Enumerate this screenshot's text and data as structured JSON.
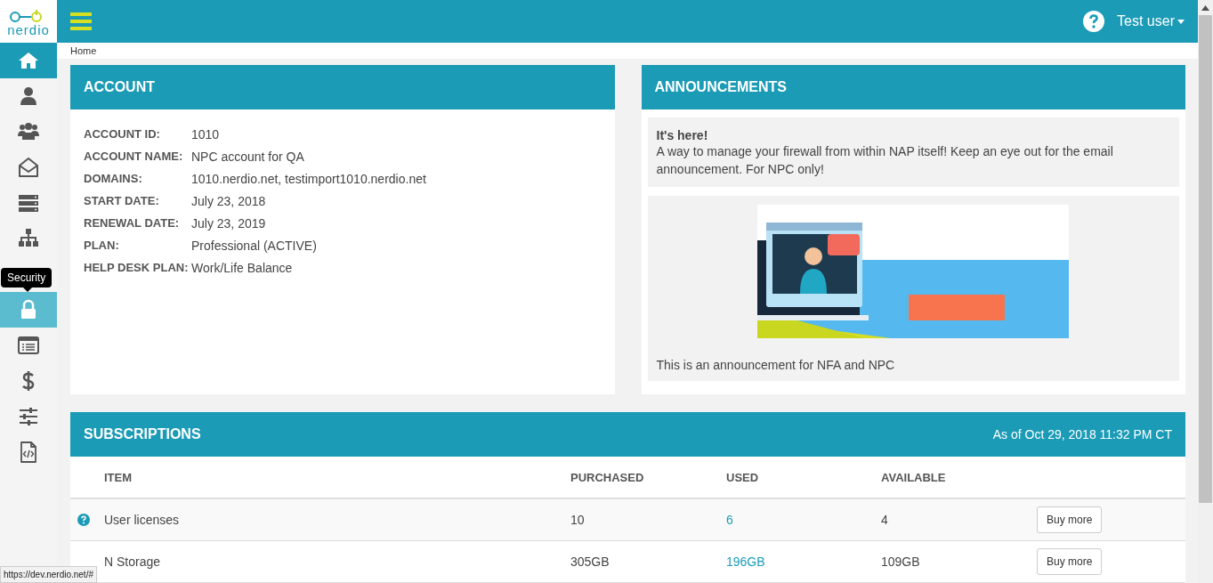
{
  "logo": {
    "text": "nerdio"
  },
  "topbar": {
    "user": "Test user"
  },
  "sidebar": {
    "items": [
      {
        "selected": true,
        "hovered": false
      },
      {
        "selected": false,
        "hovered": false
      },
      {
        "selected": false,
        "hovered": false
      },
      {
        "selected": false,
        "hovered": false
      },
      {
        "selected": false,
        "hovered": false
      },
      {
        "selected": false,
        "hovered": false
      },
      {
        "selected": false,
        "hovered": true
      },
      {
        "selected": false,
        "hovered": false
      },
      {
        "selected": false,
        "hovered": false
      },
      {
        "selected": false,
        "hovered": false
      },
      {
        "selected": false,
        "hovered": false
      }
    ],
    "tooltip": "Security"
  },
  "breadcrumb": "Home",
  "account": {
    "title": "ACCOUNT",
    "fields": [
      {
        "label": "ACCOUNT ID:",
        "value": "1010"
      },
      {
        "label": "ACCOUNT NAME:",
        "value": "NPC account for QA"
      },
      {
        "label": "DOMAINS:",
        "value": "1010.nerdio.net, testimport1010.nerdio.net"
      },
      {
        "label": "START DATE:",
        "value": "July 23, 2018"
      },
      {
        "label": "RENEWAL DATE:",
        "value": "July 23, 2019"
      },
      {
        "label": "PLAN:",
        "value": "Professional (ACTIVE)"
      },
      {
        "label": "HELP DESK PLAN:",
        "value": "Work/Life Balance"
      }
    ]
  },
  "announcements": {
    "title": "ANNOUNCEMENTS",
    "items": [
      {
        "heading": "It's here!",
        "text": "A way to manage your firewall from within NAP itself! Keep an eye out for the email announcement. For NPC only!"
      },
      {
        "kind": "picture",
        "text": "This is an announcement for NFA and NPC"
      }
    ]
  },
  "subscriptions": {
    "title": "SUBSCRIPTIONS",
    "as_of": "As of Oct 29, 2018 11:32 PM CT",
    "columns": [
      "ITEM",
      "PURCHASED",
      "USED",
      "AVAILABLE"
    ],
    "rows": [
      {
        "help": true,
        "item": "User licenses",
        "purchased": "10",
        "used": "6",
        "available": "4",
        "button": "Buy more"
      },
      {
        "help": false,
        "item": "N Storage",
        "purchased": "305GB",
        "used": "196GB",
        "available": "109GB",
        "button": "Buy more"
      }
    ]
  },
  "status_url": "https://dev.nerdio.net/#"
}
